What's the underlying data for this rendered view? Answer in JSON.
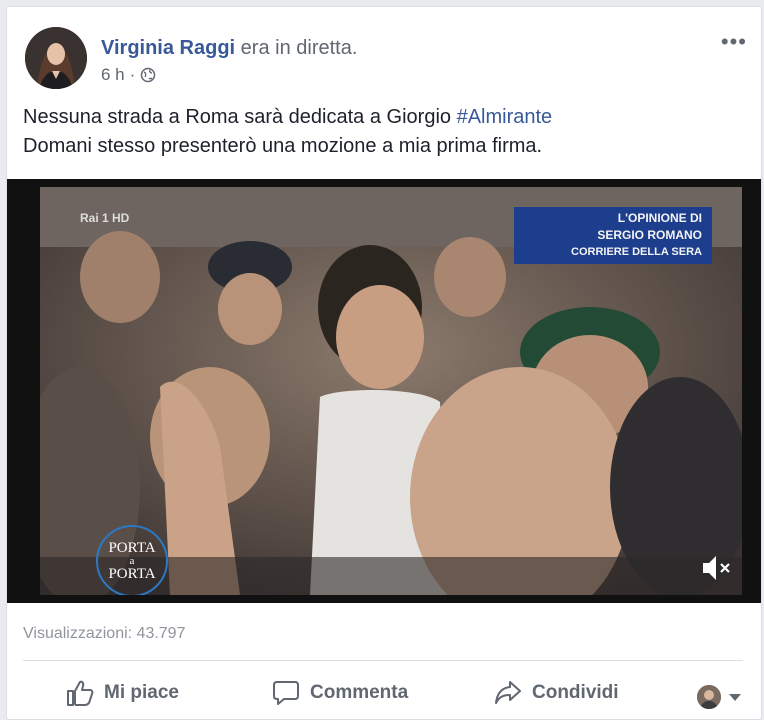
{
  "post": {
    "author": "Virginia Raggi",
    "status": "era in diretta.",
    "time": "6 h",
    "separator": "·",
    "privacy_icon": "globe-icon",
    "text_line1": "Nessuna strada a Roma sarà dedicata a Giorgio ",
    "hashtag": "#Almirante",
    "text_line2": "Domani stesso presenterò una mozione a mia prima firma."
  },
  "video": {
    "channel_logo": "Rai 1 HD",
    "overlay": {
      "line1": "L'OPINIONE DI",
      "line2": "SERGIO ROMANO",
      "line3": "CORRIERE DELLA SERA"
    },
    "show_logo": {
      "line1": "PORTA",
      "line2": "a",
      "line3": "PORTA"
    },
    "mute_icon": "volume-muted-icon"
  },
  "stats": {
    "views": "Visualizzazioni: 43.797"
  },
  "actions": {
    "like": "Mi piace",
    "comment": "Commenta",
    "share": "Condividi"
  },
  "colors": {
    "link": "#385898",
    "secondary": "#616770",
    "overlay_blue": "#1c3e8c",
    "porta_ring": "#2b78c4"
  }
}
